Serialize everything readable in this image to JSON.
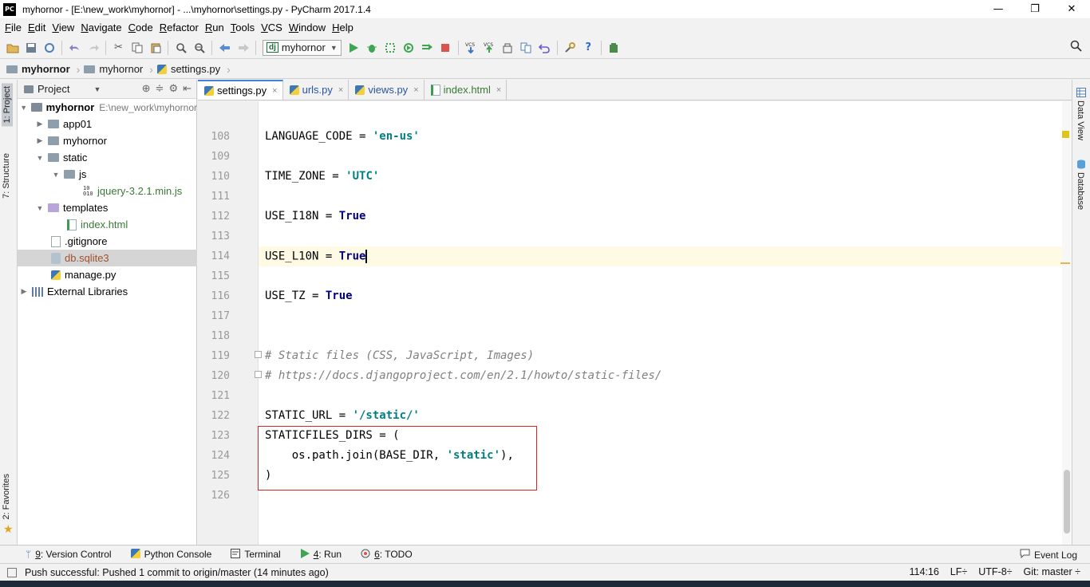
{
  "window": {
    "app_icon": "PC",
    "title": "myhornor - [E:\\new_work\\myhornor] - ...\\myhornor\\settings.py - PyCharm 2017.1.4",
    "minimize": "—",
    "restore": "❐",
    "close": "✕"
  },
  "menu": [
    "File",
    "Edit",
    "View",
    "Navigate",
    "Code",
    "Refactor",
    "Run",
    "Tools",
    "VCS",
    "Window",
    "Help"
  ],
  "toolbar": {
    "run_config_badge": "dj",
    "run_config": "myhornor",
    "vcs_label": "VCS"
  },
  "breadcrumb": {
    "root": "myhornor",
    "folder": "myhornor",
    "file": "settings.py"
  },
  "left_strip": {
    "project_tab": "1: Project",
    "structure_tab": "7: Structure",
    "favorites_tab": "2: Favorites"
  },
  "right_strip": {
    "data_view_tab": "Data View",
    "database_tab": "Database"
  },
  "project_panel": {
    "title": "Project",
    "root_name": "myhornor",
    "root_path": "E:\\new_work\\myhornor",
    "items": {
      "app01": "app01",
      "myhornor": "myhornor",
      "static": "static",
      "js": "js",
      "jquery": "jquery-3.2.1.min.js",
      "templates": "templates",
      "index": "index.html",
      "gitignore": ".gitignore",
      "db": "db.sqlite3",
      "manage": "manage.py",
      "external": "External Libraries"
    }
  },
  "tabs": {
    "settings": "settings.py",
    "urls": "urls.py",
    "views": "views.py",
    "index": "index.html",
    "close_glyph": "×"
  },
  "editor": {
    "line_numbers": [
      "108",
      "109",
      "110",
      "111",
      "112",
      "113",
      "114",
      "115",
      "116",
      "117",
      "118",
      "119",
      "120",
      "121",
      "122",
      "123",
      "124",
      "125",
      "126"
    ],
    "l108a": "LANGUAGE_CODE = ",
    "l108b": "'en-us'",
    "l110a": "TIME_ZONE = ",
    "l110b": "'UTC'",
    "l112a": "USE_I18N = ",
    "l112b": "True",
    "l114a": "USE_L10N = ",
    "l114b": "True",
    "l116a": "USE_TZ = ",
    "l116b": "True",
    "l119": "# Static files (CSS, JavaScript, Images)",
    "l120": "# https://docs.djangoproject.com/en/2.1/howto/static-files/",
    "l122a": "STATIC_URL = ",
    "l122b": "'/static/'",
    "l123": "STATICFILES_DIRS = (",
    "l124a": "    os.path.join(BASE_DIR, ",
    "l124b": "'static'",
    "l124c": "),",
    "l125": ")"
  },
  "bottom_tools": {
    "version_control_num": "9",
    "version_control": ": Version Control",
    "python_console": "Python Console",
    "terminal": "Terminal",
    "run_num": "4",
    "run": ": Run",
    "todo_num": "6",
    "todo": ": TODO",
    "event_log": "Event Log"
  },
  "status": {
    "message": "Push successful: Pushed 1 commit to origin/master (14 minutes ago)",
    "position": "114:16",
    "line_sep": "LF÷",
    "encoding": "UTF-8÷",
    "git": "Git: master ÷"
  }
}
